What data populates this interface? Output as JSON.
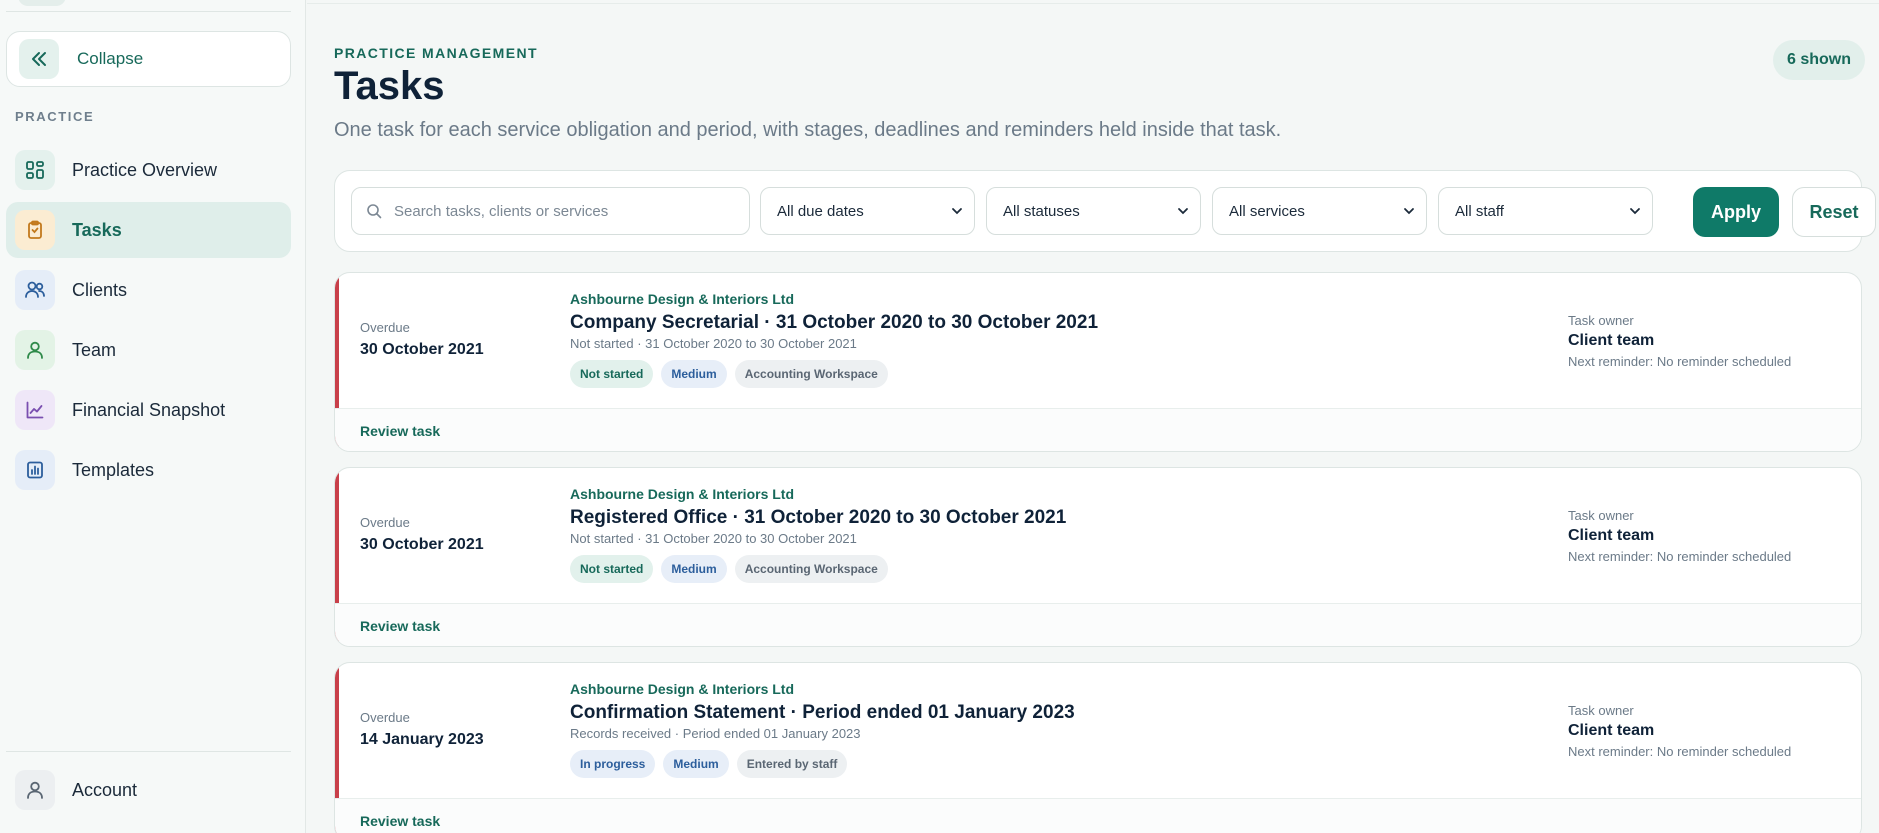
{
  "sidebar": {
    "collapse_label": "Collapse",
    "section_label": "PRACTICE",
    "items": [
      {
        "label": "Practice Overview",
        "icon": "dashboard-icon",
        "active": false
      },
      {
        "label": "Tasks",
        "icon": "clipboard-icon",
        "active": true
      },
      {
        "label": "Clients",
        "icon": "users-icon",
        "active": false
      },
      {
        "label": "Team",
        "icon": "user-icon",
        "active": false
      },
      {
        "label": "Financial Snapshot",
        "icon": "line-chart-icon",
        "active": false
      },
      {
        "label": "Templates",
        "icon": "bar-chart-icon",
        "active": false
      }
    ],
    "account_label": "Account"
  },
  "header": {
    "eyebrow": "PRACTICE MANAGEMENT",
    "title": "Tasks",
    "subtitle": "One task for each service obligation and period, with stages, deadlines and reminders held inside that task.",
    "shown_badge": "6 shown"
  },
  "filters": {
    "search_placeholder": "Search tasks, clients or services",
    "due_dates": "All due dates",
    "statuses": "All statuses",
    "services": "All services",
    "staff": "All staff",
    "apply_label": "Apply",
    "reset_label": "Reset"
  },
  "tasks": [
    {
      "due_label": "Overdue",
      "due_date": "30 October 2021",
      "client": "Ashbourne Design & Interiors Ltd",
      "title": "Company Secretarial · 31 October 2020 to 30 October 2021",
      "meta": "Not started · 31 October 2020 to 30 October 2021",
      "status_tag": "Not started",
      "priority_tag": "Medium",
      "source_tag": "Accounting Workspace",
      "owner_label": "Task owner",
      "owner": "Client team",
      "reminder": "Next reminder: No reminder scheduled",
      "review_label": "Review task"
    },
    {
      "due_label": "Overdue",
      "due_date": "30 October 2021",
      "client": "Ashbourne Design & Interiors Ltd",
      "title": "Registered Office · 31 October 2020 to 30 October 2021",
      "meta": "Not started · 31 October 2020 to 30 October 2021",
      "status_tag": "Not started",
      "priority_tag": "Medium",
      "source_tag": "Accounting Workspace",
      "owner_label": "Task owner",
      "owner": "Client team",
      "reminder": "Next reminder: No reminder scheduled",
      "review_label": "Review task"
    },
    {
      "due_label": "Overdue",
      "due_date": "14 January 2023",
      "client": "Ashbourne Design & Interiors Ltd",
      "title": "Confirmation Statement · Period ended 01 January 2023",
      "meta": "Records received · Period ended 01 January 2023",
      "status_tag": "In progress",
      "priority_tag": "Medium",
      "source_tag": "Entered by staff",
      "owner_label": "Task owner",
      "owner": "Client team",
      "reminder": "Next reminder: No reminder scheduled",
      "review_label": "Review task"
    }
  ],
  "colors": {
    "accent": "#0f7a68",
    "overdue": "#c8404a",
    "active_nav": "#dfeeea"
  }
}
